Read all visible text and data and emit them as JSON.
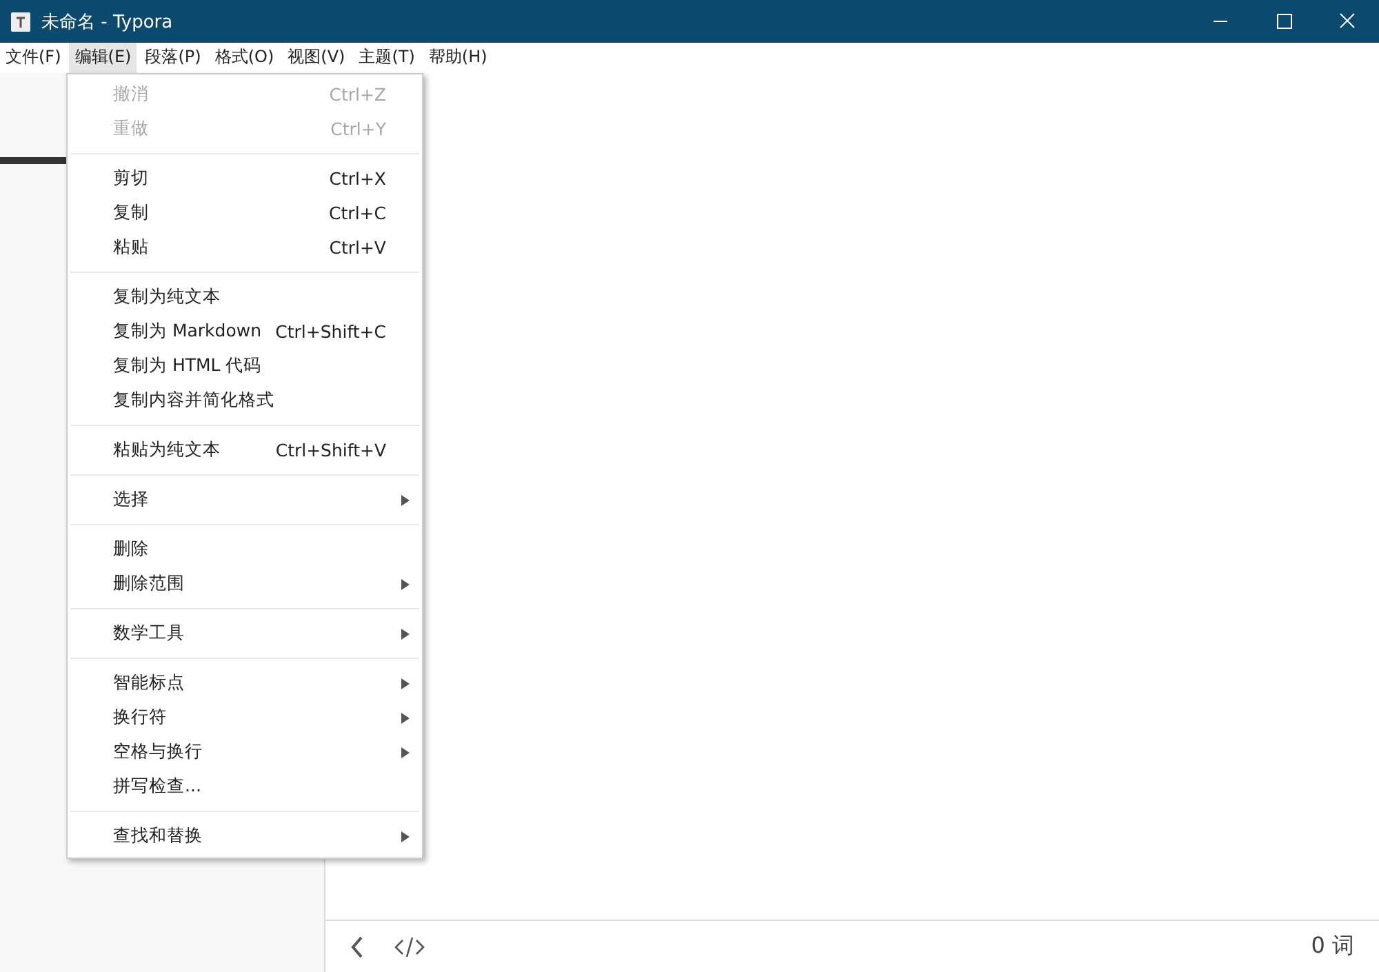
{
  "window": {
    "title": "未命名 - Typora"
  },
  "menubar": [
    {
      "label": "文件(F)",
      "selected": false
    },
    {
      "label": "编辑(E)",
      "selected": true
    },
    {
      "label": "段落(P)",
      "selected": false
    },
    {
      "label": "格式(O)",
      "selected": false
    },
    {
      "label": "视图(V)",
      "selected": false
    },
    {
      "label": "主题(T)",
      "selected": false
    },
    {
      "label": "帮助(H)",
      "selected": false
    }
  ],
  "menu": {
    "groups": [
      [
        {
          "label": "撤消",
          "shortcut": "Ctrl+Z",
          "disabled": true,
          "submenu": false
        },
        {
          "label": "重做",
          "shortcut": "Ctrl+Y",
          "disabled": true,
          "submenu": false
        }
      ],
      [
        {
          "label": "剪切",
          "shortcut": "Ctrl+X",
          "disabled": false,
          "submenu": false
        },
        {
          "label": "复制",
          "shortcut": "Ctrl+C",
          "disabled": false,
          "submenu": false
        },
        {
          "label": "粘贴",
          "shortcut": "Ctrl+V",
          "disabled": false,
          "submenu": false
        }
      ],
      [
        {
          "label": "复制为纯文本",
          "disabled": false,
          "submenu": false
        },
        {
          "label": "复制为 Markdown",
          "shortcut": "Ctrl+Shift+C",
          "disabled": false,
          "submenu": false
        },
        {
          "label": "复制为 HTML 代码",
          "disabled": false,
          "submenu": false
        },
        {
          "label": "复制内容并简化格式",
          "disabled": false,
          "submenu": false
        }
      ],
      [
        {
          "label": "粘贴为纯文本",
          "shortcut": "Ctrl+Shift+V",
          "disabled": false,
          "submenu": false
        }
      ],
      [
        {
          "label": "选择",
          "disabled": false,
          "submenu": true
        }
      ],
      [
        {
          "label": "删除",
          "disabled": false,
          "submenu": false
        },
        {
          "label": "删除范围",
          "disabled": false,
          "submenu": true
        }
      ],
      [
        {
          "label": "数学工具",
          "disabled": false,
          "submenu": true
        }
      ],
      [
        {
          "label": "智能标点",
          "disabled": false,
          "submenu": true
        },
        {
          "label": "换行符",
          "disabled": false,
          "submenu": true
        },
        {
          "label": "空格与换行",
          "disabled": false,
          "submenu": true
        },
        {
          "label": "拼写检查...",
          "disabled": false,
          "submenu": false
        }
      ],
      [
        {
          "label": "查找和替换",
          "disabled": false,
          "submenu": true
        }
      ]
    ]
  },
  "status_bar": {
    "word_count": "0 词"
  }
}
